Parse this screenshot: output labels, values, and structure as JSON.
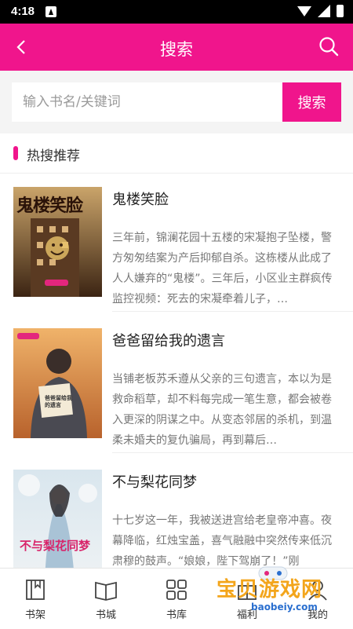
{
  "status": {
    "time": "4:18"
  },
  "header": {
    "title": "搜索"
  },
  "search": {
    "placeholder": "输入书名/关键词",
    "button": "搜索"
  },
  "section": {
    "title": "热搜推荐"
  },
  "books": [
    {
      "title": "鬼楼笑脸",
      "cover_text": "鬼楼笑脸",
      "description": "三年前，锦澜花园十五楼的宋凝抱子坠楼，警方匆匆结案为产后抑郁自杀。这栋楼从此成了人人嫌弃的“鬼楼”。三年后，小区业主群疯传监控视频：死去的宋凝牵着儿子，…"
    },
    {
      "title": "爸爸留给我的遗言",
      "cover_text": "爸爸留给我的遗言",
      "description": "当铺老板苏禾遵从父亲的三句遗言，本以为是救命稻草，却不料每完成一笔生意，都会被卷入更深的阴谋之中。从变态邻居的杀机，到温柔未婚夫的复仇骗局，再到幕后…"
    },
    {
      "title": "不与梨花同梦",
      "cover_text": "不与梨花同梦",
      "description": "十七岁这一年，我被送进宫给老皇帝冲喜。夜幕降临，红烛宝盖，喜气融融中突然传来低沉肃穆的鼓声。“娘娘，陛下驾崩了！”刚"
    }
  ],
  "tabs": [
    {
      "label": "书架",
      "icon": "bookshelf-icon"
    },
    {
      "label": "书城",
      "icon": "open-book-icon"
    },
    {
      "label": "书库",
      "icon": "grid-icon"
    },
    {
      "label": "福利",
      "icon": "gift-icon"
    },
    {
      "label": "我的",
      "icon": "user-icon"
    }
  ],
  "watermark": {
    "line1": "宝贝游戏网",
    "line2": "baobeiy.com"
  },
  "colors": {
    "accent": "#f0158c"
  }
}
